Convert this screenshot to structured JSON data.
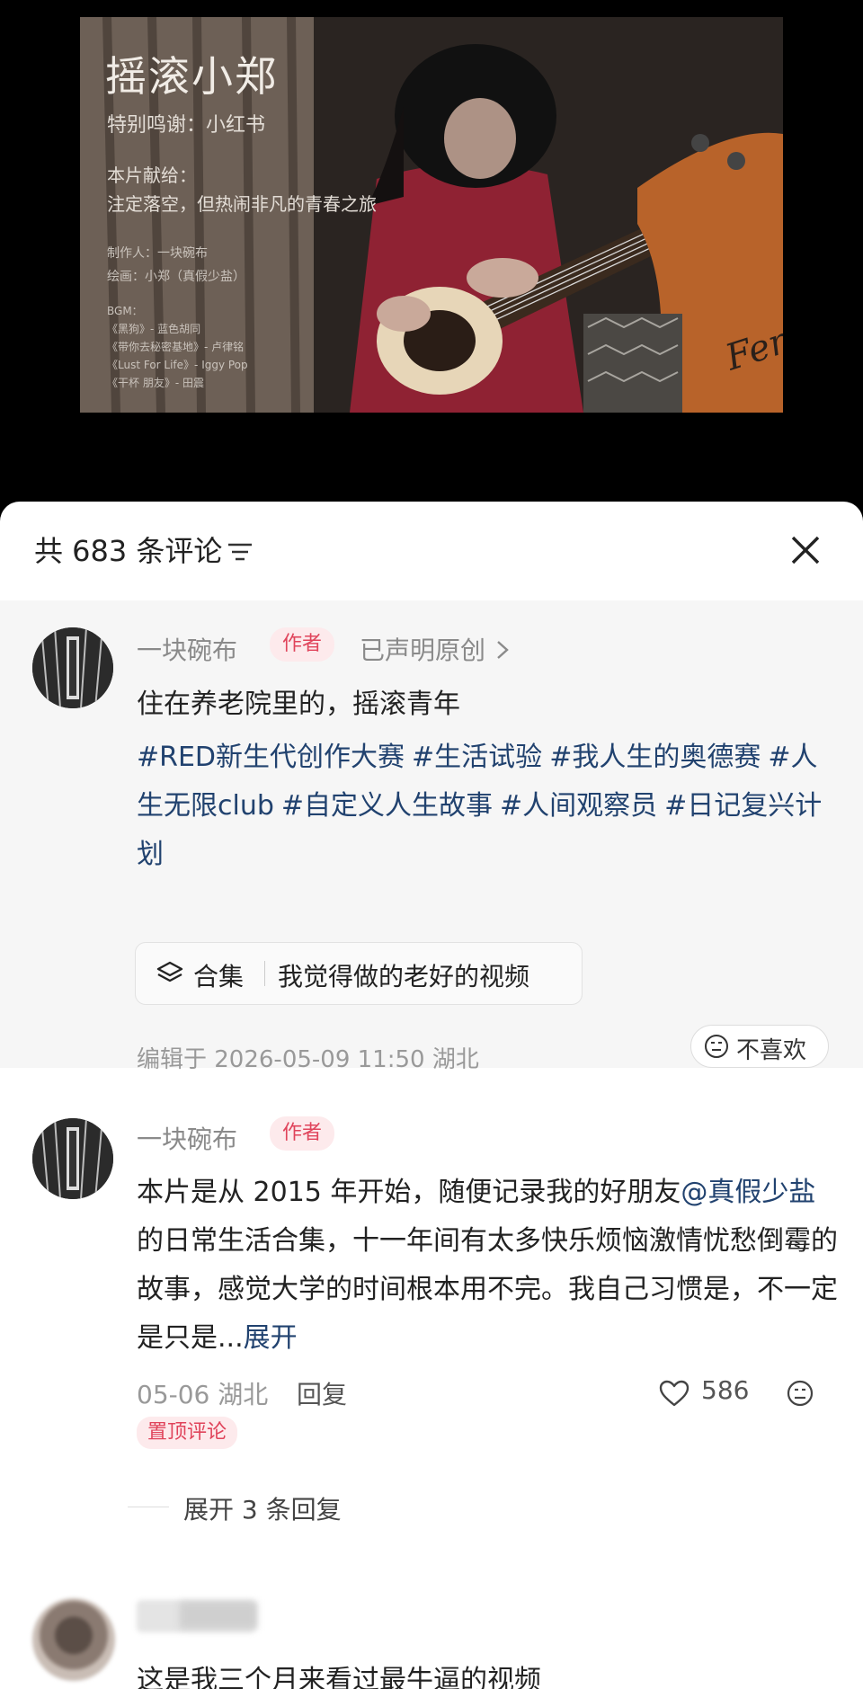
{
  "video": {
    "title": "摇滚小郑",
    "special_thanks": "特别鸣谢：小红书",
    "dedication_label": "本片献给：",
    "dedication_text": "注定落空，但热闹非凡的青春之旅",
    "producer": "制作人：一块碗布",
    "painter": "绘画：小郑（真假少盐）",
    "bgm_label": "BGM：",
    "bgm": [
      "《黑狗》- 蓝色胡同",
      "《带你去秘密基地》- 卢律铭",
      "《Lust For Life》- Iggy Pop",
      "《干杯 朋友》- 田震"
    ],
    "brand_text": "Fen"
  },
  "sheet": {
    "comment_count": "共 683 条评论"
  },
  "post": {
    "author": "一块碗布",
    "author_badge": "作者",
    "original_tag": "已声明原创",
    "text": "住在养老院里的，摇滚青年",
    "hashtags": [
      "#RED新生代创作大赛",
      "#生活试验",
      "#我人生的奥德赛",
      "#人生无限club",
      "#自定义人生故事",
      "#人间观察员",
      "#日记复兴计划"
    ],
    "collection_label": "合集",
    "collection_title": "我觉得做的老好的视频",
    "edited_info": "编辑于 2026-05-09 11:50 湖北",
    "dislike_label": "不喜欢"
  },
  "pinned_comment": {
    "author": "一块碗布",
    "author_badge": "作者",
    "text_before": "本片是从 2015 年开始，随便记录我的好朋友",
    "mention": "@真假少盐",
    "text_after": " 的日常生活合集，十一年间有太多快乐烦恼激情忧愁倒霉的故事，感觉大学的时间根本用不完。我自己习惯是，不一定是只是...",
    "expand_label": "展开",
    "meta": "05-06 湖北",
    "reply_label": "回复",
    "likes": "586",
    "pinned_badge": "置顶评论",
    "expand_replies": "展开 3 条回复"
  },
  "next_comment": {
    "text": "这是我三个月来看过最牛逼的视频"
  },
  "colors": {
    "badge_red": "#e0445b",
    "badge_bg": "#fdeaec",
    "hashtag_blue": "#21426f",
    "muted": "#999999"
  }
}
